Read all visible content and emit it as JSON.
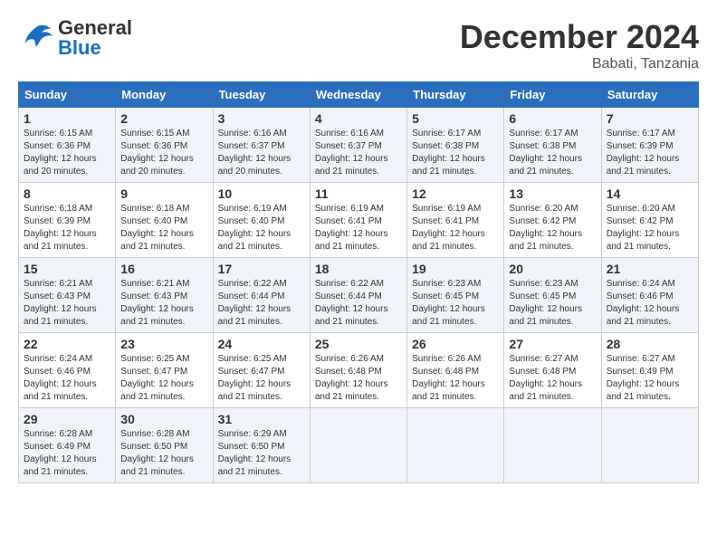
{
  "header": {
    "logo_general": "General",
    "logo_blue": "Blue",
    "month": "December 2024",
    "location": "Babati, Tanzania"
  },
  "days_of_week": [
    "Sunday",
    "Monday",
    "Tuesday",
    "Wednesday",
    "Thursday",
    "Friday",
    "Saturday"
  ],
  "weeks": [
    [
      {
        "day": "1",
        "info": "Sunrise: 6:15 AM\nSunset: 6:36 PM\nDaylight: 12 hours\nand 20 minutes."
      },
      {
        "day": "2",
        "info": "Sunrise: 6:15 AM\nSunset: 6:36 PM\nDaylight: 12 hours\nand 20 minutes."
      },
      {
        "day": "3",
        "info": "Sunrise: 6:16 AM\nSunset: 6:37 PM\nDaylight: 12 hours\nand 20 minutes."
      },
      {
        "day": "4",
        "info": "Sunrise: 6:16 AM\nSunset: 6:37 PM\nDaylight: 12 hours\nand 21 minutes."
      },
      {
        "day": "5",
        "info": "Sunrise: 6:17 AM\nSunset: 6:38 PM\nDaylight: 12 hours\nand 21 minutes."
      },
      {
        "day": "6",
        "info": "Sunrise: 6:17 AM\nSunset: 6:38 PM\nDaylight: 12 hours\nand 21 minutes."
      },
      {
        "day": "7",
        "info": "Sunrise: 6:17 AM\nSunset: 6:39 PM\nDaylight: 12 hours\nand 21 minutes."
      }
    ],
    [
      {
        "day": "8",
        "info": "Sunrise: 6:18 AM\nSunset: 6:39 PM\nDaylight: 12 hours\nand 21 minutes."
      },
      {
        "day": "9",
        "info": "Sunrise: 6:18 AM\nSunset: 6:40 PM\nDaylight: 12 hours\nand 21 minutes."
      },
      {
        "day": "10",
        "info": "Sunrise: 6:19 AM\nSunset: 6:40 PM\nDaylight: 12 hours\nand 21 minutes."
      },
      {
        "day": "11",
        "info": "Sunrise: 6:19 AM\nSunset: 6:41 PM\nDaylight: 12 hours\nand 21 minutes."
      },
      {
        "day": "12",
        "info": "Sunrise: 6:19 AM\nSunset: 6:41 PM\nDaylight: 12 hours\nand 21 minutes."
      },
      {
        "day": "13",
        "info": "Sunrise: 6:20 AM\nSunset: 6:42 PM\nDaylight: 12 hours\nand 21 minutes."
      },
      {
        "day": "14",
        "info": "Sunrise: 6:20 AM\nSunset: 6:42 PM\nDaylight: 12 hours\nand 21 minutes."
      }
    ],
    [
      {
        "day": "15",
        "info": "Sunrise: 6:21 AM\nSunset: 6:43 PM\nDaylight: 12 hours\nand 21 minutes."
      },
      {
        "day": "16",
        "info": "Sunrise: 6:21 AM\nSunset: 6:43 PM\nDaylight: 12 hours\nand 21 minutes."
      },
      {
        "day": "17",
        "info": "Sunrise: 6:22 AM\nSunset: 6:44 PM\nDaylight: 12 hours\nand 21 minutes."
      },
      {
        "day": "18",
        "info": "Sunrise: 6:22 AM\nSunset: 6:44 PM\nDaylight: 12 hours\nand 21 minutes."
      },
      {
        "day": "19",
        "info": "Sunrise: 6:23 AM\nSunset: 6:45 PM\nDaylight: 12 hours\nand 21 minutes."
      },
      {
        "day": "20",
        "info": "Sunrise: 6:23 AM\nSunset: 6:45 PM\nDaylight: 12 hours\nand 21 minutes."
      },
      {
        "day": "21",
        "info": "Sunrise: 6:24 AM\nSunset: 6:46 PM\nDaylight: 12 hours\nand 21 minutes."
      }
    ],
    [
      {
        "day": "22",
        "info": "Sunrise: 6:24 AM\nSunset: 6:46 PM\nDaylight: 12 hours\nand 21 minutes."
      },
      {
        "day": "23",
        "info": "Sunrise: 6:25 AM\nSunset: 6:47 PM\nDaylight: 12 hours\nand 21 minutes."
      },
      {
        "day": "24",
        "info": "Sunrise: 6:25 AM\nSunset: 6:47 PM\nDaylight: 12 hours\nand 21 minutes."
      },
      {
        "day": "25",
        "info": "Sunrise: 6:26 AM\nSunset: 6:48 PM\nDaylight: 12 hours\nand 21 minutes."
      },
      {
        "day": "26",
        "info": "Sunrise: 6:26 AM\nSunset: 6:48 PM\nDaylight: 12 hours\nand 21 minutes."
      },
      {
        "day": "27",
        "info": "Sunrise: 6:27 AM\nSunset: 6:48 PM\nDaylight: 12 hours\nand 21 minutes."
      },
      {
        "day": "28",
        "info": "Sunrise: 6:27 AM\nSunset: 6:49 PM\nDaylight: 12 hours\nand 21 minutes."
      }
    ],
    [
      {
        "day": "29",
        "info": "Sunrise: 6:28 AM\nSunset: 6:49 PM\nDaylight: 12 hours\nand 21 minutes."
      },
      {
        "day": "30",
        "info": "Sunrise: 6:28 AM\nSunset: 6:50 PM\nDaylight: 12 hours\nand 21 minutes."
      },
      {
        "day": "31",
        "info": "Sunrise: 6:29 AM\nSunset: 6:50 PM\nDaylight: 12 hours\nand 21 minutes."
      },
      {
        "day": "",
        "info": ""
      },
      {
        "day": "",
        "info": ""
      },
      {
        "day": "",
        "info": ""
      },
      {
        "day": "",
        "info": ""
      }
    ]
  ]
}
